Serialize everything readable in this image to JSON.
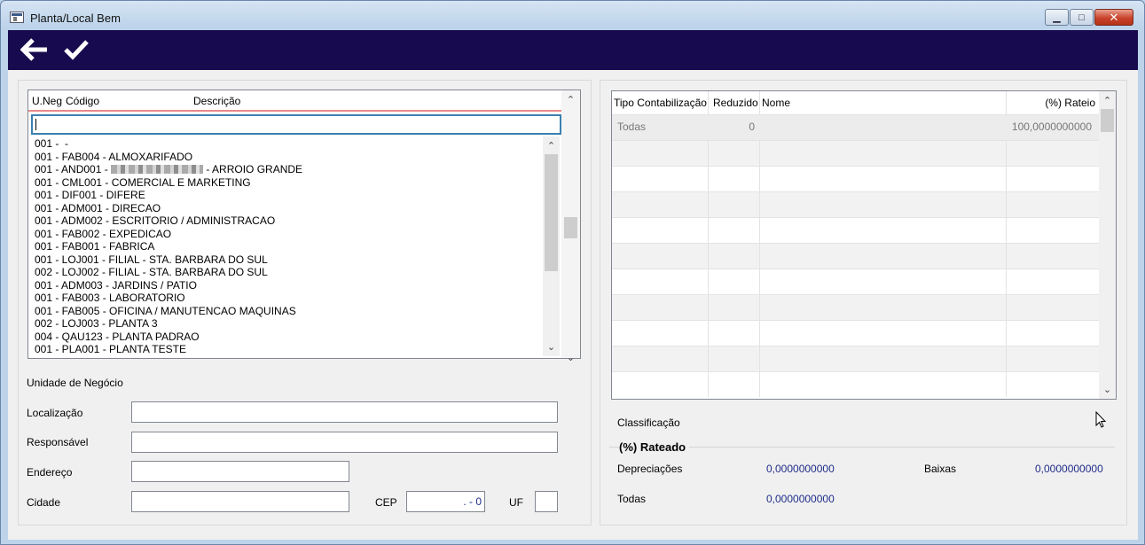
{
  "window": {
    "title": "Planta/Local Bem",
    "min_icon": "minimize-icon",
    "max_icon": "maximize-icon",
    "close_icon": "close-icon"
  },
  "toolbar": {
    "back_icon": "arrow-left-icon",
    "confirm_icon": "checkmark-icon"
  },
  "list": {
    "columns": [
      "U.Neg",
      "Código",
      "Descrição"
    ],
    "search_value": "",
    "items": [
      "001 -  -",
      "001 - FAB004 - ALMOXARIFADO",
      "001 - AND001 - ",
      "001 - CML001 - COMERCIAL E MARKETING",
      "001 - DIF001 - DIFERE",
      "001 - ADM001 - DIRECAO",
      "001 - ADM002 - ESCRITORIO / ADMINISTRACAO",
      "001 - FAB002 - EXPEDICAO",
      "001 - FAB001 - FABRICA",
      "001 - LOJ001 - FILIAL - STA. BARBARA DO SUL",
      "002 - LOJ002 - FILIAL - STA. BARBARA DO SUL",
      "001 - ADM003 - JARDINS / PATIO",
      "001 - FAB003 - LABORATORIO",
      "001 - FAB005 - OFICINA / MANUTENCAO MAQUINAS",
      "002 - LOJ003 - PLANTA 3",
      "004 - QAU123 - PLANTA PADRAO",
      "001 - PLA001 - PLANTA TESTE"
    ],
    "item3_suffix": " - ARROIO GRANDE"
  },
  "form": {
    "unidade_label": "Unidade de Negócio",
    "localizacao_label": "Localização",
    "responsavel_label": "Responsável",
    "endereco_label": "Endereço",
    "cidade_label": "Cidade",
    "cep_label": "CEP",
    "cep_value": ".   - 0",
    "uf_label": "UF",
    "localizacao_value": "",
    "responsavel_value": "",
    "endereco_value": "",
    "cidade_value": "",
    "uf_value": ""
  },
  "grid": {
    "columns": [
      "Tipo Contabilização",
      "Reduzido",
      "Nome",
      "(%) Rateio"
    ],
    "rows": [
      {
        "tipo": "Todas",
        "reduzido": "0",
        "nome": "",
        "rateio": "100,0000000000"
      }
    ]
  },
  "rateado": {
    "classificacao_label": "Classificação",
    "title": "(%) Rateado",
    "depreciacoes_label": "Depreciações",
    "depreciacoes_value": "0,0000000000",
    "baixas_label": "Baixas",
    "baixas_value": "0,0000000000",
    "todas_label": "Todas",
    "todas_value": "0,0000000000"
  },
  "colors": {
    "toolbar_bg": "#180a4e",
    "value_text": "#1f2d8a",
    "focus_border": "#3c7fb1",
    "header_accent": "#e98888"
  }
}
